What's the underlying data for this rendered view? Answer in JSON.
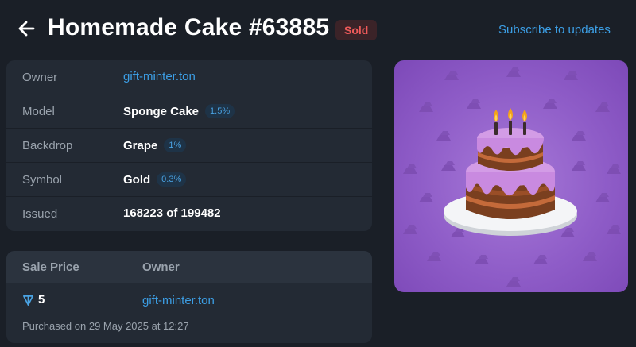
{
  "header": {
    "title": "Homemade Cake #63885",
    "status_badge": "Sold",
    "subscribe_label": "Subscribe to updates"
  },
  "details": [
    {
      "label": "Owner",
      "value": "gift-minter.ton"
    },
    {
      "label": "Model",
      "value": "Sponge Cake",
      "rarity": "1.5%"
    },
    {
      "label": "Backdrop",
      "value": "Grape",
      "rarity": "1%"
    },
    {
      "label": "Symbol",
      "value": "Gold",
      "rarity": "0.3%"
    },
    {
      "label": "Issued",
      "value": "168223 of 199482"
    }
  ],
  "sale": {
    "col_price": "Sale Price",
    "col_owner": "Owner",
    "price": "5",
    "currency_icon": "ton-icon",
    "owner": "gift-minter.ton",
    "purchased": "Purchased on 29 May 2025 at 12:27"
  },
  "artwork": {
    "icon": "cake-icon",
    "backdrop_color": "#8f5dc8",
    "pattern_icon": "gold-bars-icon"
  },
  "colors": {
    "accent": "#3c9fe6",
    "sold": "#ef5a5a",
    "background": "#1a1f27",
    "card": "#232a34"
  }
}
